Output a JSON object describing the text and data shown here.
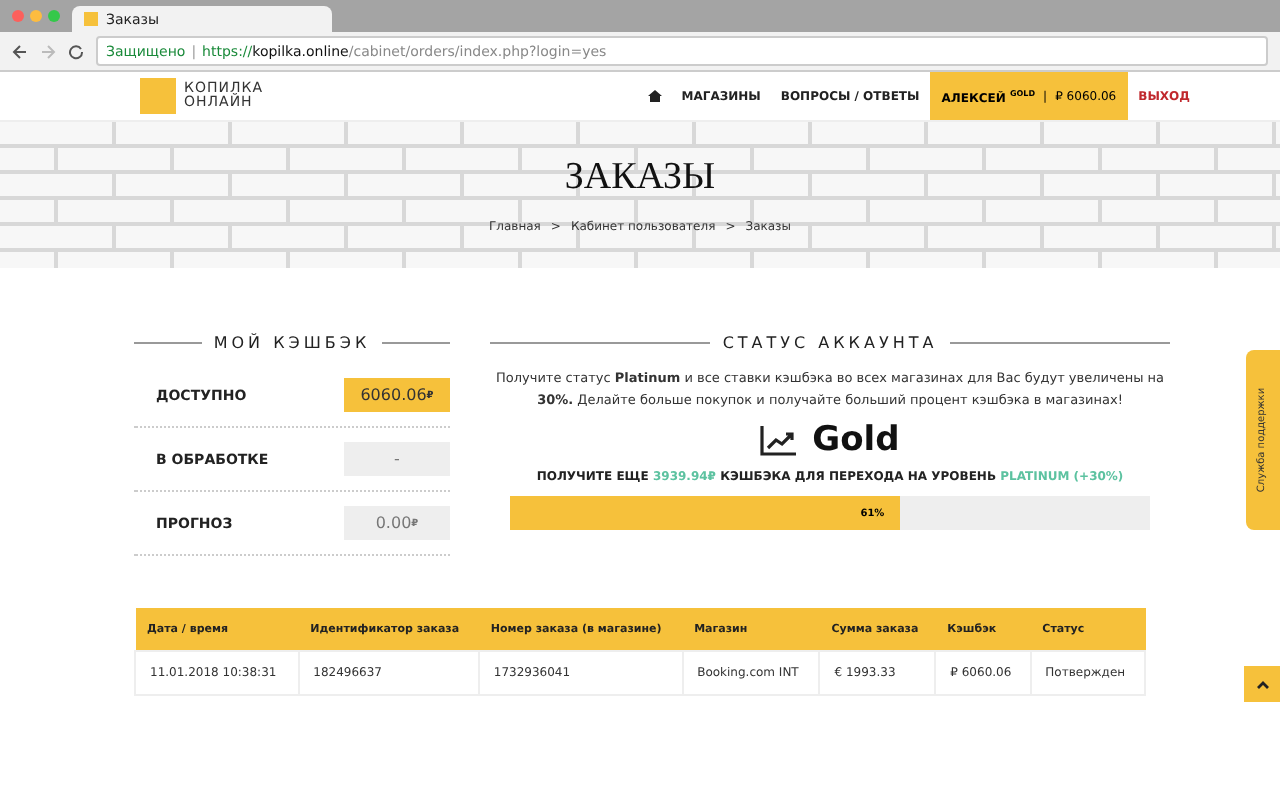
{
  "browser": {
    "tab_title": "Заказы",
    "secure_label": "Защищено",
    "secure_separator": "|",
    "url_scheme": "https://",
    "url_host": "kopilka.online",
    "url_path": "/cabinet/orders/index.php?login=yes"
  },
  "nav": {
    "logo_top": "КОПИЛКА",
    "logo_bottom": "ОНЛАЙН",
    "items": [
      {
        "label": "МАГАЗИНЫ"
      },
      {
        "label": "ВОПРОСЫ / ОТВЕТЫ"
      }
    ],
    "user": {
      "name": "АЛЕКСЕЙ",
      "level": "GOLD",
      "separator": "|",
      "balance": "₽ 6060.06"
    },
    "logout": "ВЫХОД"
  },
  "hero": {
    "title": "ЗАКАЗЫ",
    "breadcrumbs": [
      {
        "label": "Главная"
      },
      {
        "label": "Кабинет пользователя"
      },
      {
        "label": "Заказы"
      }
    ],
    "separator": ">"
  },
  "cashback": {
    "title": "МОЙ КЭШБЭК",
    "rows": [
      {
        "label": "ДОСТУПНО",
        "value": "6060.06",
        "currency": "₽",
        "highlighted": true
      },
      {
        "label": "В ОБРАБОТКЕ",
        "value": "-",
        "highlighted": false
      },
      {
        "label": "ПРОГНОЗ",
        "value": "0.00",
        "currency": "₽",
        "highlighted": false
      }
    ]
  },
  "status": {
    "title": "СТАТУС АККАУНТА",
    "description": "Получите статус **Platinum** и все ставки кэшбэка во всех магазинах для Вас будут увеличены на **30%.** Делайте больше покупок и получайте больший процент кэшбэка в магазинах!",
    "level_name": "Gold",
    "goal_parts": [
      {
        "text": "ПОЛУЧИТЕ ЕЩЕ",
        "accent": false
      },
      {
        "text": "3939.94₽",
        "accent": true
      },
      {
        "text": "КЭШБЭКА ДЛЯ ПЕРЕХОДА НА УРОВЕНЬ",
        "accent": false
      },
      {
        "text": "PLATINUM",
        "accent": true
      },
      {
        "text": "(+30%)",
        "accent": true
      }
    ],
    "progress": {
      "level": 0.61,
      "label": "61%"
    }
  },
  "orders": {
    "columns": [
      "Дата / время",
      "Идентификатор заказа",
      "Номер заказа (в магазине)",
      "Магазин",
      "Сумма заказа",
      "Кэшбэк",
      "Статус"
    ],
    "rows": [
      [
        "11.01.2018 10:38:31",
        "182496637",
        "1732936041",
        "Booking.com INT",
        "€ 1993.33",
        "₽ 6060.06",
        "Потвержден"
      ]
    ]
  },
  "support_tab": "Служба поддержки"
}
